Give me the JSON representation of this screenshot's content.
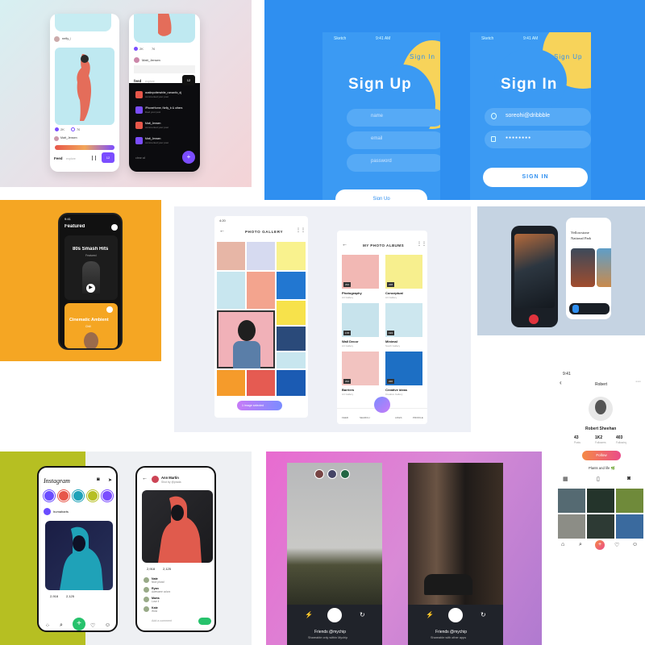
{
  "colors": {
    "blue": "#2f8ff0",
    "yellow": "#f7d35a",
    "orange": "#f5a623",
    "purple": "#7b4dff",
    "pink": "#e86bd0",
    "olive": "#b6bf22"
  },
  "social_feed": {
    "status_time": "9:41",
    "username": "nelly_l",
    "likes": "2K",
    "comments": "76",
    "tab_feed": "Feed",
    "tab_explore": "explore",
    "post_user": "Matt_Jensen",
    "badge": "12",
    "counts": [
      "2K",
      "76"
    ],
    "dark_tab_feed": "feed",
    "dark_tab_explore": "explore",
    "notifications": [
      {
        "text": "austinpotterwhite_romantic_dj",
        "sub": "commented your post"
      },
      {
        "text": "iPhoneHome, Nelly_b & others",
        "sub": "liked your post"
      },
      {
        "text": "Matt_Jensen",
        "sub": "commented your post"
      },
      {
        "text": "Matt_Jensen",
        "sub": "commented your post"
      }
    ],
    "clear_all": "clear all"
  },
  "signup": {
    "status_carrier": "Sketch",
    "status_time": "9:41 AM",
    "title": "Sign Up",
    "corner_link": "Sign In",
    "fields": [
      "name",
      "email",
      "password"
    ],
    "cta": "Sign Up"
  },
  "signin": {
    "status_carrier": "Sketch",
    "status_time": "9:41 AM",
    "title": "Sign In",
    "corner_link": "Sign Up",
    "email_value": "soreohi@dribbble",
    "password_mask": "●●●●●●●●",
    "cta": "SIGN IN"
  },
  "music": {
    "status_time": "9:41",
    "header": "Featured",
    "card1_title": "80s Smash Hits",
    "card1_sub": "Featured",
    "card2_title": "Cinematic Ambient",
    "card2_sub": "Chill"
  },
  "gallery": {
    "status_time": "4:20",
    "title": "PHOTO GALLERY",
    "select_button": "1 image selected",
    "albums_title": "MY PHOTO ALBUMS",
    "albums": [
      {
        "name": "Photography",
        "sub": "Art Gallery",
        "count": "234"
      },
      {
        "name": "Conceptual",
        "sub": "Art Gallery",
        "count": "228"
      },
      {
        "name": "Wall Decor",
        "sub": "Art Gallery",
        "count": "178"
      },
      {
        "name": "Minimal",
        "sub": "South Gallery",
        "count": "193"
      },
      {
        "name": "Barriers",
        "sub": "Art Gallery",
        "count": "234"
      },
      {
        "name": "Creative ideas",
        "sub": "Creative Gallery",
        "count": "226"
      }
    ],
    "nav": [
      "FEED",
      "SEARCH",
      "",
      "LIKES",
      "PROFILE"
    ]
  },
  "park": {
    "title_line1": "Yellowstone",
    "title_line2": "National Park"
  },
  "profile": {
    "status_time": "9:41",
    "header": "Robert",
    "name": "Robert Sheehan",
    "stats": [
      {
        "value": "43",
        "label": "Posts"
      },
      {
        "value": "1K2",
        "label": "Followers"
      },
      {
        "value": "403",
        "label": "Following"
      }
    ],
    "follow": "Follow",
    "section": "Plants and life 🌿"
  },
  "instagram": {
    "logo": "Instagram",
    "post_user": "humaharts",
    "post_likes": "2,918",
    "post_comments": "2,125",
    "detail_user": "Ann Martin",
    "detail_sub": "Shot by @prada",
    "detail_likes": "2,918",
    "detail_comments": "2,125",
    "comments": [
      {
        "user": "Nate",
        "text": "Nice photo!"
      },
      {
        "user": "Ryan",
        "text": "Awesome colors"
      },
      {
        "user": "Marta",
        "text": "Love it"
      },
      {
        "user": "Kate",
        "text": "Wow"
      }
    ],
    "add_comment": "Add a comment"
  },
  "camera": {
    "caption1": "Friends @mychip",
    "sub1": "Shareable only within Mychip",
    "caption2": "Friends @mychip",
    "sub2": "Shareable with other apps"
  }
}
